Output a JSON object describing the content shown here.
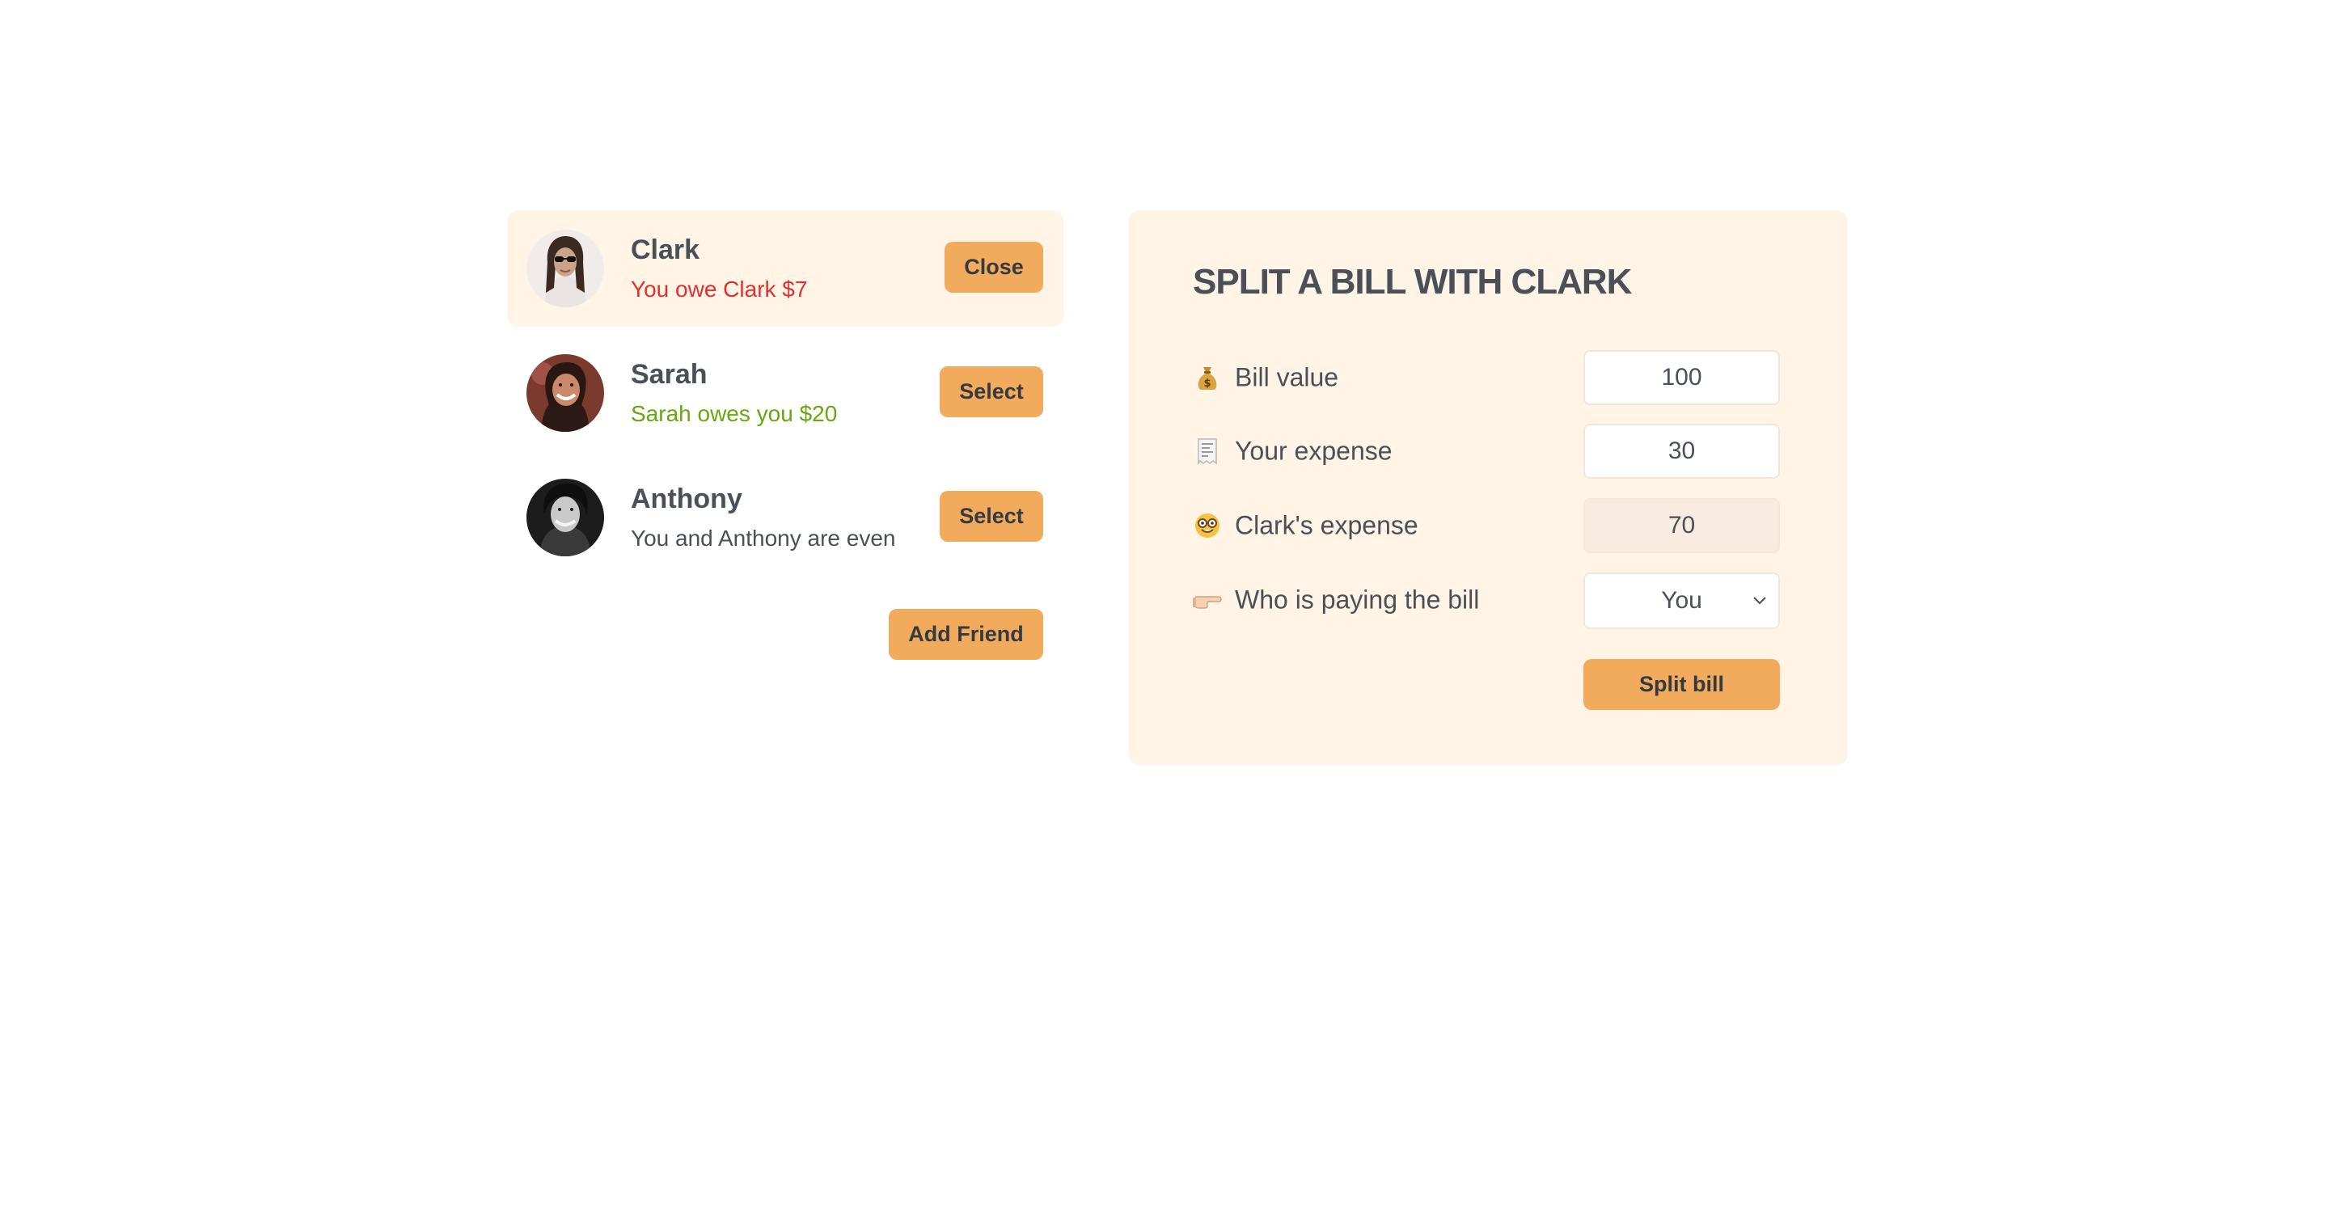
{
  "friends": [
    {
      "name": "Clark",
      "status": "You owe Clark $7",
      "status_type": "owe",
      "status_color": "#e03131",
      "button_label": "Close",
      "selected": true,
      "avatar_icon": "avatar-clark"
    },
    {
      "name": "Sarah",
      "status": "Sarah owes you $20",
      "status_type": "owed",
      "status_color": "#66a80f",
      "button_label": "Select",
      "selected": false,
      "avatar_icon": "avatar-sarah"
    },
    {
      "name": "Anthony",
      "status": "You and Anthony are even",
      "status_type": "even",
      "status_color": "#495057",
      "button_label": "Select",
      "selected": false,
      "avatar_icon": "avatar-anthony"
    }
  ],
  "sidebar": {
    "add_friend_label": "Add Friend"
  },
  "split_form": {
    "title": "SPLIT A BILL WITH CLARK",
    "rows": {
      "bill_value": {
        "icon": "money-bag-icon",
        "label": "Bill value",
        "value": "100"
      },
      "your_expense": {
        "icon": "receipt-icon",
        "label": "Your expense",
        "value": "30"
      },
      "friend_expense": {
        "icon": "nerd-face-icon",
        "label": "Clark's expense",
        "value": "70"
      },
      "payer": {
        "icon": "pointing-hand-icon",
        "label": "Who is paying the bill",
        "selected": "You"
      }
    },
    "submit_label": "Split bill"
  },
  "colors": {
    "accent": "#f2ab5c",
    "panel_background": "#fff4e6",
    "text": "#495057",
    "owe_red": "#e03131",
    "owed_green": "#66a80f"
  }
}
